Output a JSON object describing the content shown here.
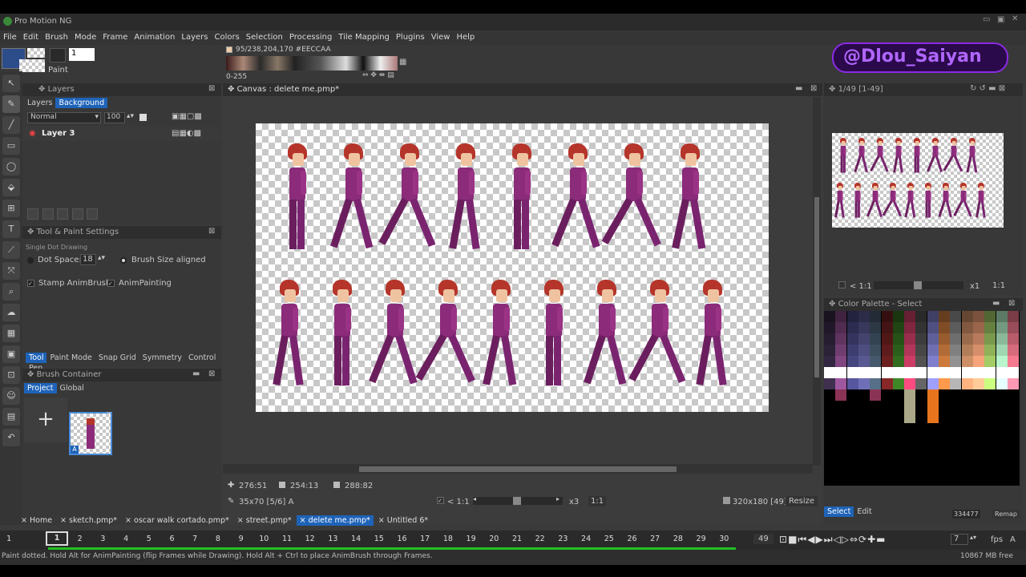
{
  "app": {
    "title": "Pro Motion NG"
  },
  "menu": [
    "File",
    "Edit",
    "Brush",
    "Mode",
    "Frame",
    "Animation",
    "Layers",
    "Colors",
    "Selection",
    "Processing",
    "Tile Mapping",
    "Plugins",
    "View",
    "Help"
  ],
  "watermark": "@Dlou_Saiyan",
  "toolbar": {
    "paint_label": "Paint",
    "brush_size": "1",
    "color_info": "95/238,204,170 #EECCAA",
    "range": "0-255"
  },
  "layers_panel": {
    "title": "Layers",
    "tabs": [
      "Layers",
      "Background"
    ],
    "blend_mode": "Normal",
    "opacity": "100",
    "layer_name": "Layer 3"
  },
  "tool_settings": {
    "title": "Tool & Paint Settings",
    "subtitle": "Single Dot Drawing",
    "dot_space_label": "Dot Space:",
    "dot_space_value": "18",
    "brush_aligned_label": "Brush Size aligned",
    "stamp_label": "Stamp AnimBrush",
    "animpainting_label": "AnimPainting",
    "tabs": [
      "Tool",
      "Paint Mode",
      "Snap Grid",
      "Symmetry",
      "Control",
      "Pen"
    ]
  },
  "brush_container": {
    "title": "Brush Container",
    "tabs": [
      "Project",
      "Global"
    ],
    "add_label": "+",
    "brush_badge": "A"
  },
  "canvas": {
    "title": "Canvas : delete me.pmp*",
    "cursor_pos": "276:51",
    "selection_pos": "254:13",
    "selection_size": "288:82",
    "brush_info": "35x70 [5/6] A",
    "zoom_min": "< 1:1",
    "zoom_factor": "x3",
    "zoom_ratio": "1:1",
    "canvas_size": "320x180 [49]",
    "resize_label": "Resize"
  },
  "preview_panel": {
    "frame_info": "1/49 [1-49]",
    "zoom_min": "< 1:1",
    "zoom_factor": "x1",
    "zoom_ratio": "1:1"
  },
  "palette_panel": {
    "title": "Color Palette - Select",
    "tabs": [
      "Select",
      "Edit"
    ],
    "hex": "334477",
    "remap_label": "Remap"
  },
  "doc_tabs": [
    "Home",
    "sketch.pmp*",
    "oscar walk cortado.pmp*",
    "street.pmp*",
    "delete me.pmp*",
    "Untitled 6*"
  ],
  "frames": {
    "current": "1",
    "first_label": "1",
    "numbers": [
      "1",
      "2",
      "3",
      "4",
      "5",
      "6",
      "7",
      "8",
      "9",
      "10",
      "11",
      "12",
      "13",
      "14",
      "15",
      "16",
      "17",
      "18",
      "19",
      "20",
      "21",
      "22",
      "23",
      "24",
      "25",
      "26",
      "27",
      "28",
      "29",
      "30"
    ],
    "total": "49",
    "fps_value": "7",
    "fps_label": "fps"
  },
  "status": {
    "message": "Paint dotted. Hold Alt for AnimPainting (flip Frames while Drawing). Hold Alt + Ctrl to place AnimBrush through Frames.",
    "memory": "10867 MB free"
  },
  "colors": {
    "accent": "#1e63b8",
    "sprite_shirt": "#8b2b7a",
    "sprite_hair": "#b5352a",
    "frame_bar": "#22c022"
  }
}
